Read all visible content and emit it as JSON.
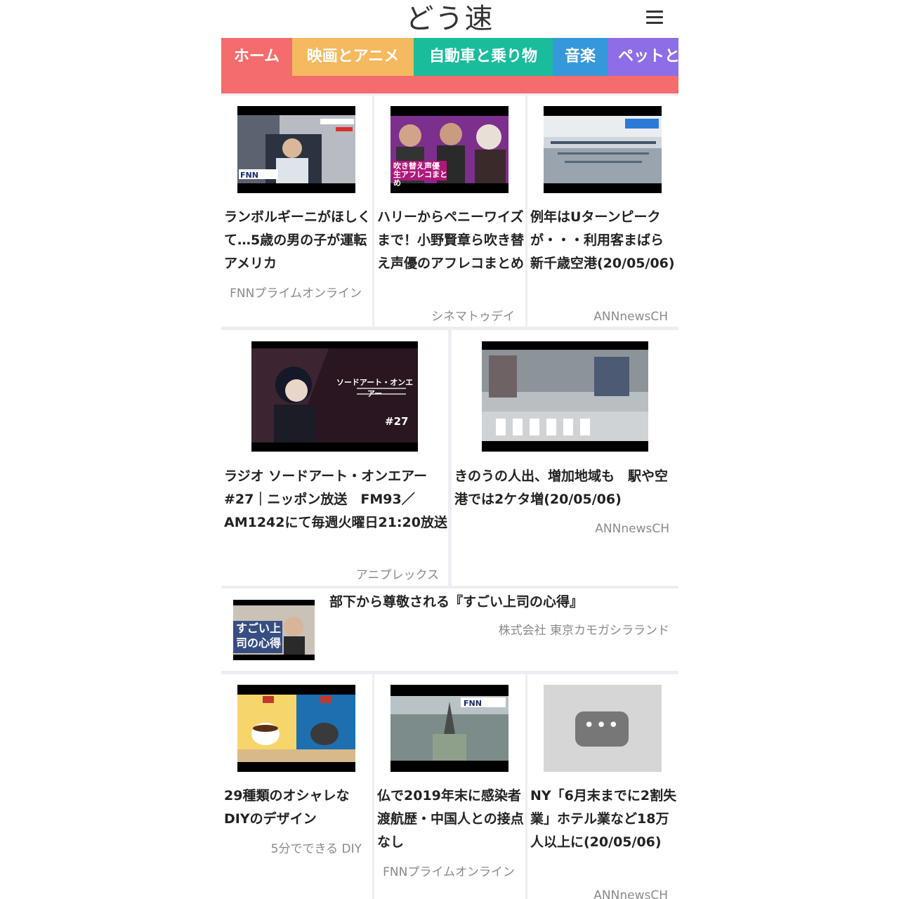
{
  "app": {
    "logo": "どう速"
  },
  "tabs": [
    {
      "label": "ホーム",
      "color": "#f56c6c"
    },
    {
      "label": "映画とアニメ",
      "color": "#f5b95f"
    },
    {
      "label": "自動車と乗り物",
      "color": "#1abc9c"
    },
    {
      "label": "音楽",
      "color": "#3498db"
    },
    {
      "label": "ペットと",
      "color": "#8e6ee6"
    }
  ],
  "accent_color": "#f56c6c",
  "articles": [
    {
      "title": "ランボルギーニがほしくて…5歳の男の子が運転　アメリカ",
      "source": "FNNプライムオンライン"
    },
    {
      "title": "ハリーからペニーワイズまで！小野賢章ら吹き替え声優のアフレコまとめ",
      "source": "シネマトゥデイ",
      "thumb_caption": "吹き替え声優 生アフレコまとめ"
    },
    {
      "title": "例年はUターンピークが・・・利用客まばら　新千歳空港(20/05/06)",
      "source": "ANNnewsCH"
    },
    {
      "title": "ラジオ ソードアート・オンエアー#27｜ニッポン放送　FM93／AM1242にて毎週火曜日21:20放送",
      "source": "アニプレックス",
      "thumb_caption": "ソードアート・オンエアー",
      "thumb_badge": "#27"
    },
    {
      "title": "きのうの人出、増加地域も　駅や空港では2ケタ増(20/05/06)",
      "source": "ANNnewsCH"
    },
    {
      "title": "部下から尊敬される『すごい上司の心得』",
      "source": "株式会社 東京カモガシラランド",
      "thumb_caption": "すごい上司の心得"
    },
    {
      "title": "29種類のオシャレなDIYのデザイン",
      "source": "5分でできる DIY"
    },
    {
      "title": "仏で2019年末に感染者　渡航歴・中国人との接点なし",
      "source": "FNNプライムオンライン"
    },
    {
      "title": "NY「6月末までに2割失業」ホテル業など18万人以上に(20/05/06)",
      "source": "ANNnewsCH"
    }
  ],
  "icons": {
    "menu": "hamburger-menu-icon",
    "placeholder": "more-dots-icon"
  }
}
